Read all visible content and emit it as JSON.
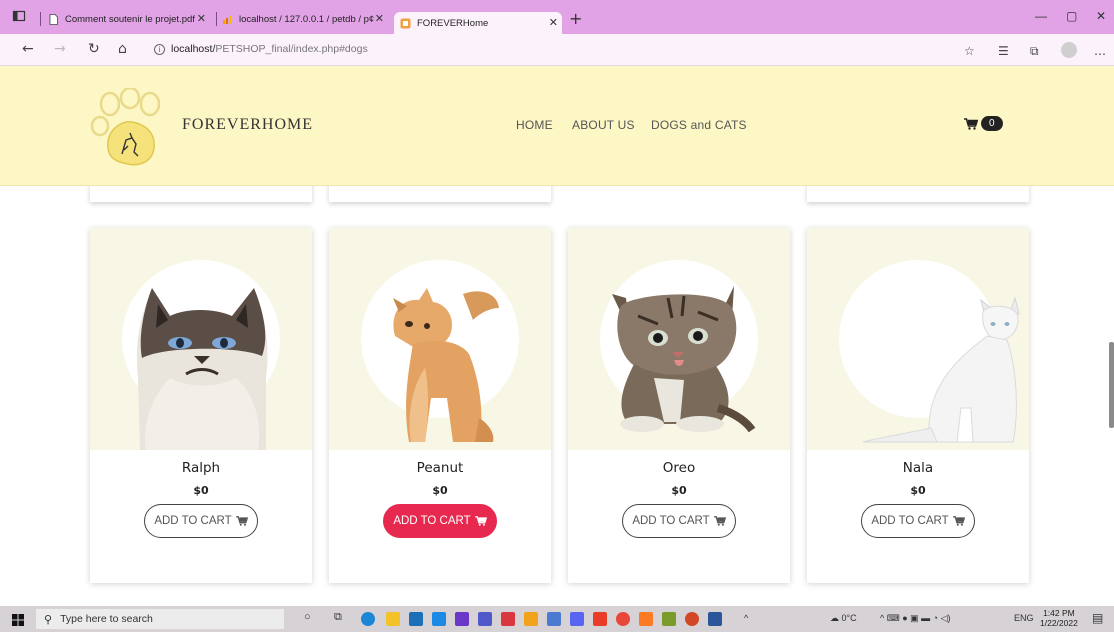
{
  "browser": {
    "tabs": [
      {
        "title": "Comment soutenir le projet.pdf",
        "icon": "document-icon"
      },
      {
        "title": "localhost / 127.0.0.1 / petdb / p¢",
        "icon": "phpmyadmin-icon"
      },
      {
        "title": "FOREVERHome",
        "icon": "site-favicon"
      }
    ],
    "url_host": "localhost/",
    "url_path": "PETSHOP_final/index.php#dogs"
  },
  "site": {
    "brand": "FOREVERHOME",
    "nav": [
      "HOME",
      "ABOUT US",
      "DOGS and CATS"
    ],
    "cart_count": "0"
  },
  "products": [
    {
      "name": "Ralph",
      "price": "$0",
      "button": "ADD TO CART",
      "highlighted": false
    },
    {
      "name": "Peanut",
      "price": "$0",
      "button": "ADD TO CART",
      "highlighted": true
    },
    {
      "name": "Oreo",
      "price": "$0",
      "button": "ADD TO CART",
      "highlighted": false
    },
    {
      "name": "Nala",
      "price": "$0",
      "button": "ADD TO CART",
      "highlighted": false
    }
  ],
  "taskbar": {
    "search_placeholder": "Type here to search",
    "weather": "0°C",
    "language": "ENG",
    "time": "1:42 PM",
    "date": "1/22/2022"
  },
  "colors": {
    "header_bg": "#fdf7c6",
    "accent": "#e8294f",
    "tabstrip": "#e1a3e6"
  }
}
